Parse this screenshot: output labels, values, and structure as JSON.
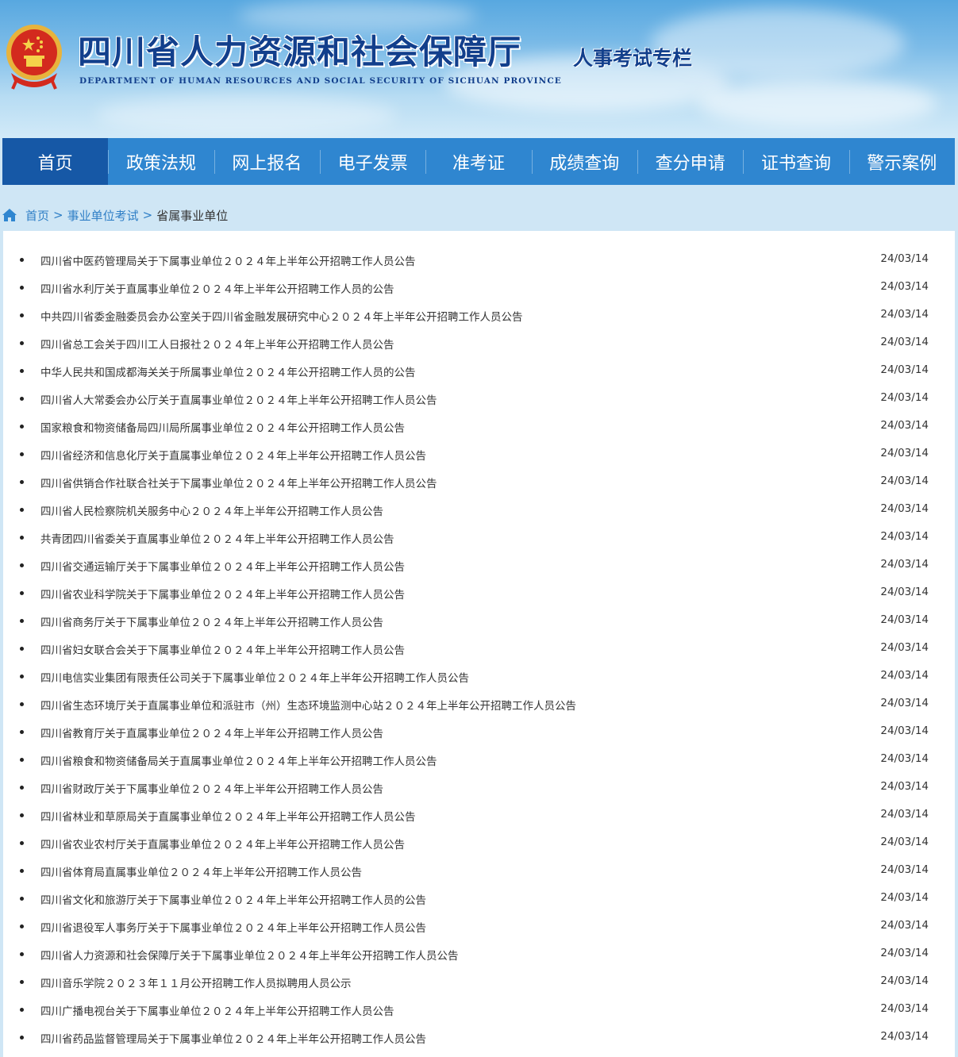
{
  "header": {
    "title_cn": "四川省人力资源和社会保障厅",
    "title_en": "DEPARTMENT OF HUMAN RESOURCES AND SOCIAL SECURITY OF SICHUAN PROVINCE",
    "subtitle": "人事考试专栏",
    "emblem_icon": "national-emblem-icon"
  },
  "nav": {
    "items": [
      {
        "label": "首页",
        "active": true
      },
      {
        "label": "政策法规"
      },
      {
        "label": "网上报名"
      },
      {
        "label": "电子发票"
      },
      {
        "label": "准考证"
      },
      {
        "label": "成绩查询"
      },
      {
        "label": "查分申请"
      },
      {
        "label": "证书查询"
      },
      {
        "label": "警示案例"
      }
    ]
  },
  "breadcrumb": {
    "icon": "home-icon",
    "home": "首页",
    "sep": ">",
    "level1": "事业单位考试",
    "current": "省属事业单位"
  },
  "list": [
    {
      "title": "四川省中医药管理局关于下属事业单位２０２４年上半年公开招聘工作人员公告",
      "date": "24/03/14"
    },
    {
      "title": "四川省水利厅关于直属事业单位２０２４年上半年公开招聘工作人员的公告",
      "date": "24/03/14"
    },
    {
      "title": "中共四川省委金融委员会办公室关于四川省金融发展研究中心２０２４年上半年公开招聘工作人员公告",
      "date": "24/03/14"
    },
    {
      "title": "四川省总工会关于四川工人日报社２０２４年上半年公开招聘工作人员公告",
      "date": "24/03/14"
    },
    {
      "title": "中华人民共和国成都海关关于所属事业单位２０２４年公开招聘工作人员的公告",
      "date": "24/03/14"
    },
    {
      "title": "四川省人大常委会办公厅关于直属事业单位２０２４年上半年公开招聘工作人员公告",
      "date": "24/03/14"
    },
    {
      "title": "国家粮食和物资储备局四川局所属事业单位２０２４年公开招聘工作人员公告",
      "date": "24/03/14"
    },
    {
      "title": "四川省经济和信息化厅关于直属事业单位２０２４年上半年公开招聘工作人员公告",
      "date": "24/03/14"
    },
    {
      "title": "四川省供销合作社联合社关于下属事业单位２０２４年上半年公开招聘工作人员公告",
      "date": "24/03/14"
    },
    {
      "title": "四川省人民检察院机关服务中心２０２４年上半年公开招聘工作人员公告",
      "date": "24/03/14"
    },
    {
      "title": "共青团四川省委关于直属事业单位２０２４年上半年公开招聘工作人员公告",
      "date": "24/03/14"
    },
    {
      "title": "四川省交通运输厅关于下属事业单位２０２４年上半年公开招聘工作人员公告",
      "date": "24/03/14"
    },
    {
      "title": "四川省农业科学院关于下属事业单位２０２４年上半年公开招聘工作人员公告",
      "date": "24/03/14"
    },
    {
      "title": "四川省商务厅关于下属事业单位２０２４年上半年公开招聘工作人员公告",
      "date": "24/03/14"
    },
    {
      "title": "四川省妇女联合会关于下属事业单位２０２４年上半年公开招聘工作人员公告",
      "date": "24/03/14"
    },
    {
      "title": "四川电信实业集团有限责任公司关于下属事业单位２０２４年上半年公开招聘工作人员公告",
      "date": "24/03/14"
    },
    {
      "title": "四川省生态环境厅关于直属事业单位和派驻市（州）生态环境监测中心站２０２４年上半年公开招聘工作人员公告",
      "date": "24/03/14"
    },
    {
      "title": "四川省教育厅关于直属事业单位２０２４年上半年公开招聘工作人员公告",
      "date": "24/03/14"
    },
    {
      "title": "四川省粮食和物资储备局关于直属事业单位２０２４年上半年公开招聘工作人员公告",
      "date": "24/03/14"
    },
    {
      "title": "四川省财政厅关于下属事业单位２０２４年上半年公开招聘工作人员公告",
      "date": "24/03/14"
    },
    {
      "title": "四川省林业和草原局关于直属事业单位２０２４年上半年公开招聘工作人员公告",
      "date": "24/03/14"
    },
    {
      "title": "四川省农业农村厅关于直属事业单位２０２４年上半年公开招聘工作人员公告",
      "date": "24/03/14"
    },
    {
      "title": "四川省体育局直属事业单位２０２４年上半年公开招聘工作人员公告",
      "date": "24/03/14"
    },
    {
      "title": "四川省文化和旅游厅关于下属事业单位２０２４年上半年公开招聘工作人员的公告",
      "date": "24/03/14"
    },
    {
      "title": "四川省退役军人事务厅关于下属事业单位２０２４年上半年公开招聘工作人员公告",
      "date": "24/03/14"
    },
    {
      "title": "四川省人力资源和社会保障厅关于下属事业单位２０２４年上半年公开招聘工作人员公告",
      "date": "24/03/14"
    },
    {
      "title": "四川音乐学院２０２３年１１月公开招聘工作人员拟聘用人员公示",
      "date": "24/03/14"
    },
    {
      "title": "四川广播电视台关于下属事业单位２０２４年上半年公开招聘工作人员公告",
      "date": "24/03/14"
    },
    {
      "title": "四川省药品监督管理局关于下属事业单位２０２４年上半年公开招聘工作人员公告",
      "date": "24/03/14"
    }
  ]
}
